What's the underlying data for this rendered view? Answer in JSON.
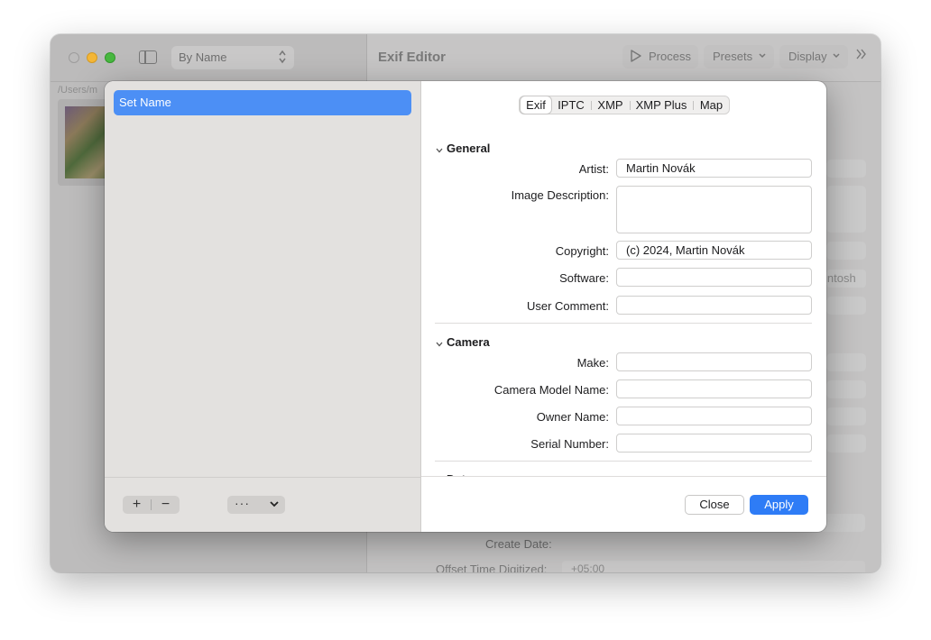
{
  "window": {
    "sort_label": "By Name",
    "path_prefix": "/Users/m",
    "title": "Exif Editor",
    "toolbar": {
      "process": "Process",
      "presets": "Presets",
      "display": "Display"
    },
    "peek": {
      "create_date_label": "Create Date:",
      "offset_label": "Offset Time Digitized:",
      "offset_value": "+05:00",
      "macintosh_fragment": "intosh"
    }
  },
  "sheet": {
    "sets": [
      {
        "label": "Set Name",
        "selected": true
      }
    ],
    "footer": {
      "add": "+",
      "remove": "−",
      "action": "···"
    },
    "tabs": [
      "Exif",
      "IPTC",
      "XMP",
      "XMP Plus",
      "Map"
    ],
    "selected_tab": "Exif",
    "sections": {
      "general": {
        "title": "General",
        "fields": {
          "artist": {
            "label": "Artist:",
            "value": "Martin Novák"
          },
          "image_description": {
            "label": "Image Description:",
            "value": ""
          },
          "copyright": {
            "label": "Copyright:",
            "value": "(c) 2024, Martin Novák"
          },
          "software": {
            "label": "Software:",
            "value": ""
          },
          "user_comment": {
            "label": "User Comment:",
            "value": ""
          }
        }
      },
      "camera": {
        "title": "Camera",
        "fields": {
          "make": {
            "label": "Make:",
            "value": ""
          },
          "model": {
            "label": "Camera Model Name:",
            "value": ""
          },
          "owner": {
            "label": "Owner Name:",
            "value": ""
          },
          "serial": {
            "label": "Serial Number:",
            "value": ""
          }
        }
      },
      "date": {
        "title": "Date"
      }
    },
    "buttons": {
      "close": "Close",
      "apply": "Apply"
    }
  },
  "colors": {
    "accent": "#2e7cf6",
    "selection": "#4c8ff5"
  }
}
